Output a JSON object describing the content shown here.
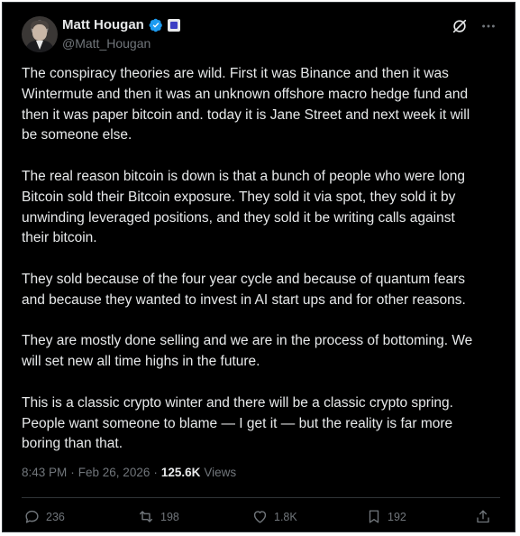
{
  "author": {
    "name": "Matt Hougan",
    "handle": "@Matt_Hougan"
  },
  "icons": {
    "verified": "verified-badge-icon",
    "affiliate": "affiliate-badge-icon",
    "grok": "grok-icon",
    "more": "more-options-icon"
  },
  "colors": {
    "background": "#000000",
    "text": "#e7e9ea",
    "muted": "#71767b",
    "verified_blue": "#1d9bf0"
  },
  "tweet": {
    "paragraphs": [
      "The conspiracy theories are wild. First it was Binance and then it was\nWintermute and then it was an unknown offshore macro hedge fund and\nthen it was paper bitcoin and. today it is Jane Street and next week it will\nbe someone else.",
      "The real reason bitcoin is down is that a bunch of people who were long\nBitcoin sold their Bitcoin exposure. They sold it via spot, they sold it by\nunwinding leveraged positions, and they sold it be writing calls against\ntheir bitcoin.",
      "They sold because of the four year cycle and because of quantum fears\nand because they wanted to invest in AI start ups and for other reasons.",
      "They are mostly done selling and we are in the process of bottoming. We\nwill set new all time highs in the future.",
      "This is a classic crypto winter and there will be a classic crypto spring.\nPeople want someone to blame — I get it — but  the reality is far more\nboring than that."
    ]
  },
  "meta": {
    "time": "8:43 PM",
    "separator": "·",
    "date": "Feb 26, 2026",
    "views_count": "125.6K",
    "views_label": "Views"
  },
  "actions": {
    "replies": "236",
    "reposts": "198",
    "likes": "1.8K",
    "bookmarks": "192"
  }
}
